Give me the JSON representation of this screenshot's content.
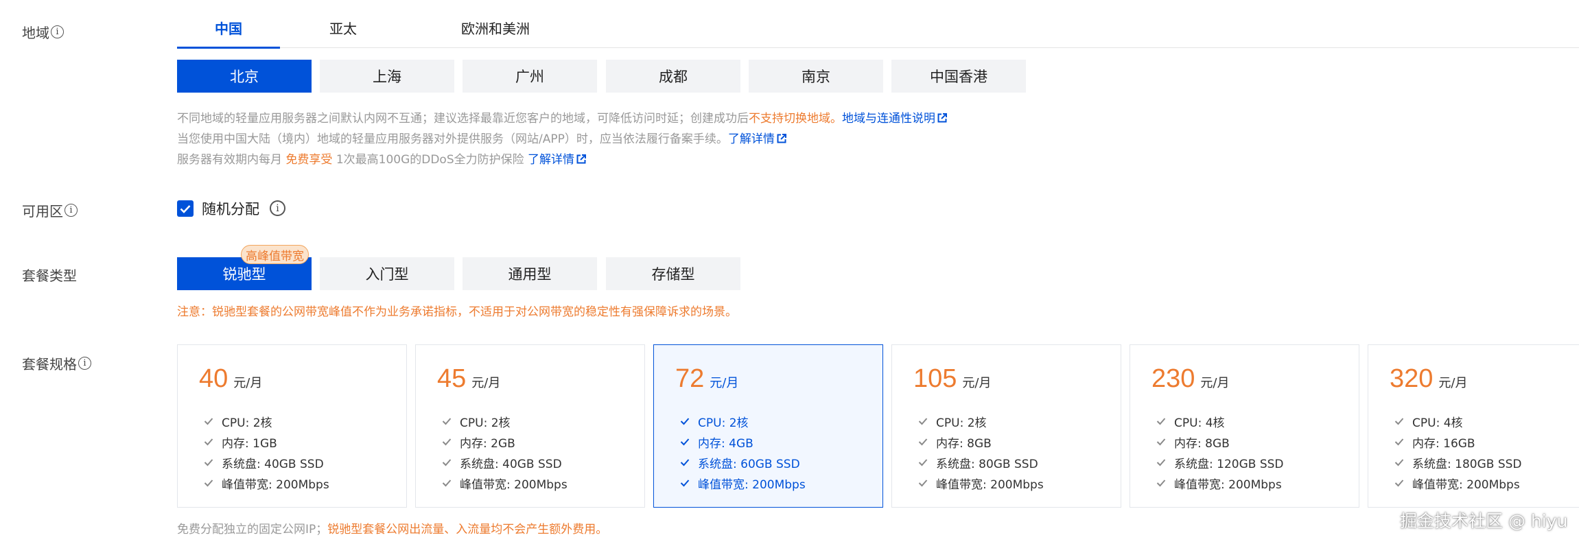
{
  "region": {
    "label": "地域",
    "tabs": [
      "中国",
      "亚太",
      "欧洲和美洲"
    ],
    "cities": [
      "北京",
      "上海",
      "广州",
      "成都",
      "南京",
      "中国香港"
    ],
    "note1": {
      "text": "不同地域的轻量应用服务器之间默认内网不互通；建议选择最靠近您客户的地域，可降低访问时延；创建成功后",
      "highlight": "不支持切换地域",
      "sep": "。",
      "link": "地域与连通性说明"
    },
    "note2": {
      "text": "当您使用中国大陆（境内）地域的轻量应用服务器对外提供服务（网站/APP）时，应当依法履行备案手续。",
      "link": "了解详情"
    },
    "note3": {
      "prefix": "服务器有效期内每月",
      "highlight": "免费享受",
      "text": "1次最高100G的DDoS全力防护保险",
      "link": "了解详情"
    }
  },
  "zone": {
    "label": "可用区",
    "checkbox_label": "随机分配",
    "checked": true
  },
  "package_type": {
    "label": "套餐类型",
    "options": [
      "锐驰型",
      "入门型",
      "通用型",
      "存储型"
    ],
    "badge": "高峰值带宽",
    "warning": "注意：锐驰型套餐的公网带宽峰值不作为业务承诺指标，不适用于对公网带宽的稳定性有强保障诉求的场景。"
  },
  "spec": {
    "label": "套餐规格",
    "unit": "元/月",
    "plans": [
      {
        "price": "40",
        "cpu": "CPU: 2核",
        "mem": "内存: 1GB",
        "disk": "系统盘: 40GB SSD",
        "bw": "峰值带宽: 200Mbps"
      },
      {
        "price": "45",
        "cpu": "CPU: 2核",
        "mem": "内存: 2GB",
        "disk": "系统盘: 40GB SSD",
        "bw": "峰值带宽: 200Mbps"
      },
      {
        "price": "72",
        "cpu": "CPU: 2核",
        "mem": "内存: 4GB",
        "disk": "系统盘: 60GB SSD",
        "bw": "峰值带宽: 200Mbps"
      },
      {
        "price": "105",
        "cpu": "CPU: 2核",
        "mem": "内存: 8GB",
        "disk": "系统盘: 80GB SSD",
        "bw": "峰值带宽: 200Mbps"
      },
      {
        "price": "230",
        "cpu": "CPU: 4核",
        "mem": "内存: 8GB",
        "disk": "系统盘: 120GB SSD",
        "bw": "峰值带宽: 200Mbps"
      },
      {
        "price": "320",
        "cpu": "CPU: 4核",
        "mem": "内存: 16GB",
        "disk": "系统盘: 180GB SSD",
        "bw": "峰值带宽: 200Mbps"
      }
    ],
    "footer_text": "免费分配独立的固定公网IP；",
    "footer_highlight": "锐驰型套餐公网出流量、入流量均不会产生额外费用。"
  },
  "watermark": "掘金技术社区 @ hiyu",
  "colors": {
    "accent": "#0052d9",
    "orange": "#ed7b2f",
    "muted": "#999999"
  }
}
